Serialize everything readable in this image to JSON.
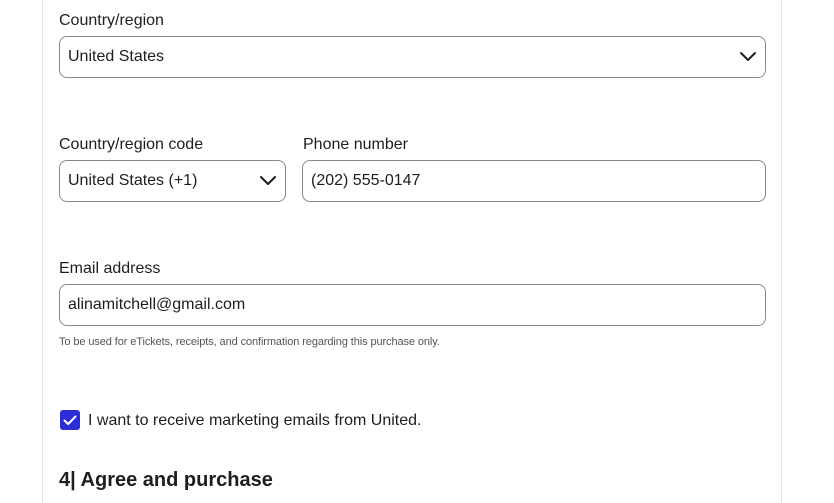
{
  "country": {
    "label": "Country/region",
    "selected": "United States"
  },
  "phone": {
    "code_label": "Country/region code",
    "code_selected": "United States (+1)",
    "number_label": "Phone number",
    "number_value": "(202) 555-0147"
  },
  "email": {
    "label": "Email address",
    "value": "alinamitchell@gmail.com",
    "help": "To be used for eTickets, receipts, and confirmation regarding this purchase only."
  },
  "marketing": {
    "checked": true,
    "label": "I want to receive marketing emails from United."
  },
  "section": {
    "title": "4| Agree and purchase"
  },
  "colors": {
    "checkbox": "#2d2dd8",
    "border": "#8a8a8a"
  },
  "icons": {
    "dropdown": "chevron-down-icon",
    "check": "check-icon"
  }
}
